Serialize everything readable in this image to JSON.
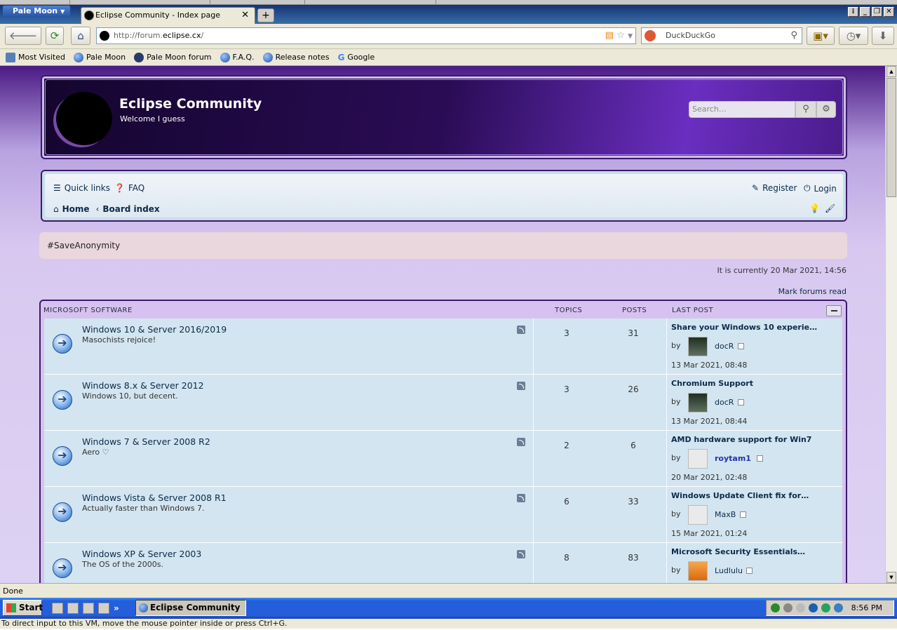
{
  "browser": {
    "app_menu": "Pale Moon",
    "tab_title": "Eclipse Community - Index page",
    "new_tab": "+",
    "url_prefix": "http://forum.",
    "url_domain": "eclipse.cx",
    "url_suffix": "/",
    "search_engine": "DuckDuckGo",
    "status": "Done",
    "bookmarks": [
      "Most Visited",
      "Pale Moon",
      "Pale Moon forum",
      "F.A.Q.",
      "Release notes",
      "Google"
    ]
  },
  "site": {
    "name": "Eclipse Community",
    "tagline": "Welcome I guess",
    "search_placeholder": "Search…",
    "nav": {
      "quick_links": "Quick links",
      "faq": "FAQ",
      "register": "Register",
      "login": "Login",
      "home": "Home",
      "board_index": "Board index"
    },
    "announcement": "#SaveAnonymity",
    "current_time": "It is currently 20 Mar 2021, 14:56",
    "mark_read": "Mark forums read"
  },
  "forum_section": {
    "title": "MICROSOFT SOFTWARE",
    "col_topics": "TOPICS",
    "col_posts": "POSTS",
    "col_last_post": "LAST POST",
    "rows": [
      {
        "title": "Windows 10 & Server 2016/2019",
        "desc": "Masochists rejoice!",
        "topics": "3",
        "posts": "31",
        "last_title": "Share your Windows 10 experie…",
        "by": "by",
        "user": "docR",
        "date": "13 Mar 2021, 08:48"
      },
      {
        "title": "Windows 8.x & Server 2012",
        "desc": "Windows 10, but decent.",
        "topics": "3",
        "posts": "26",
        "last_title": "Chromium Support",
        "by": "by",
        "user": "docR",
        "date": "13 Mar 2021, 08:44"
      },
      {
        "title": "Windows 7 & Server 2008 R2",
        "desc": "Aero ♡",
        "topics": "2",
        "posts": "6",
        "last_title": "AMD hardware support for Win7",
        "by": "by",
        "user": "roytam1",
        "date": "20 Mar 2021, 02:48"
      },
      {
        "title": "Windows Vista & Server 2008 R1",
        "desc": "Actually faster than Windows 7.",
        "topics": "6",
        "posts": "33",
        "last_title": "Windows Update Client fix for…",
        "by": "by",
        "user": "MaxB",
        "date": "15 Mar 2021, 01:24"
      },
      {
        "title": "Windows XP & Server 2003",
        "desc": "The OS of the 2000s.",
        "topics": "8",
        "posts": "83",
        "last_title": "Microsoft Security Essentials…",
        "by": "by",
        "user": "Ludlulu",
        "date": ""
      }
    ]
  },
  "taskbar": {
    "start": "Start",
    "task_title": "Eclipse Community - I...",
    "clock": "8:56 PM",
    "more": "»"
  },
  "vm_hint": "To direct input to this VM, move the mouse pointer inside or press Ctrl+G."
}
